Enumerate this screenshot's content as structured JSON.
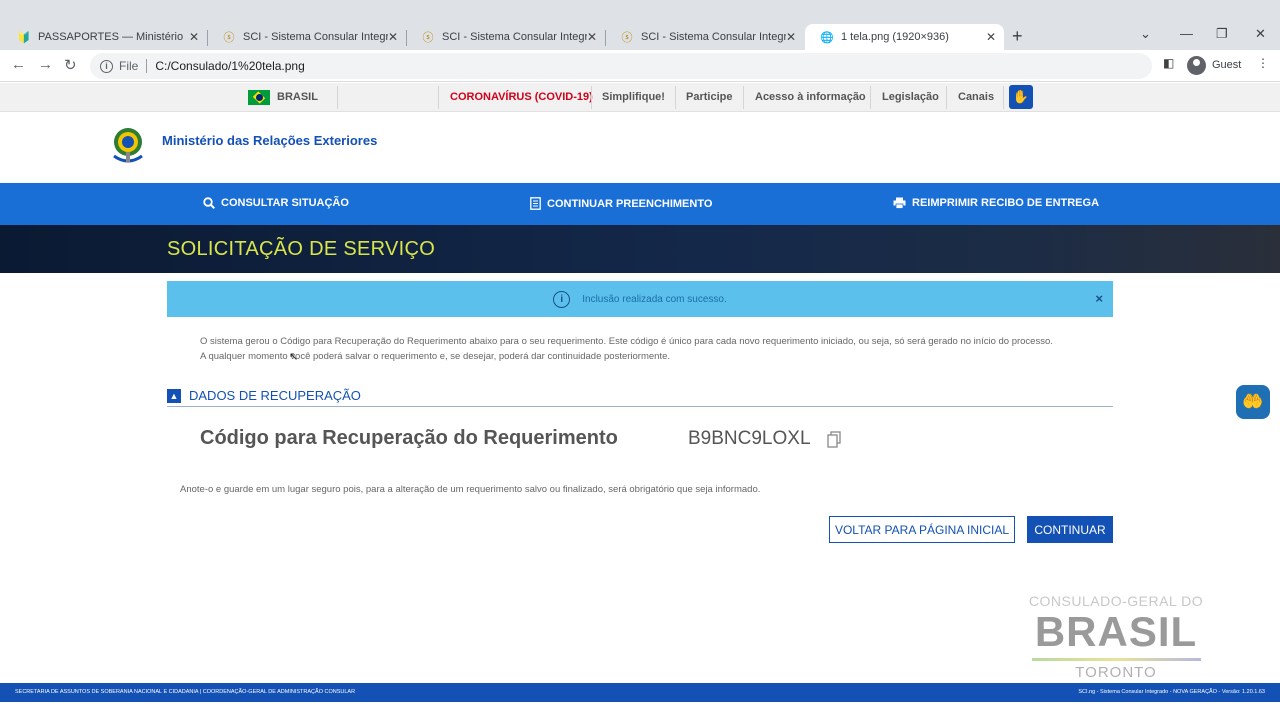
{
  "browser": {
    "tabs": [
      {
        "title": "PASSAPORTES — Ministério das",
        "icon": "gov-favicon"
      },
      {
        "title": "SCI - Sistema Consular Integrado",
        "icon": "sci-favicon"
      },
      {
        "title": "SCI - Sistema Consular Integrado",
        "icon": "sci-favicon"
      },
      {
        "title": "SCI - Sistema Consular Integrado",
        "icon": "sci-favicon"
      },
      {
        "title": "1 tela.png (1920×936)",
        "icon": "globe-icon"
      }
    ],
    "address": {
      "scheme_label": "File",
      "url": "C:/Consulado/1%20tela.png"
    },
    "profile_label": "Guest"
  },
  "govbar": {
    "country": "BRASIL",
    "links": [
      "CORONAVÍRUS (COVID-19)",
      "Simplifique!",
      "Participe",
      "Acesso à informação",
      "Legislação",
      "Canais"
    ]
  },
  "header": {
    "ministry": "Ministério das Relações Exteriores"
  },
  "nav": {
    "consultar": "CONSULTAR SITUAÇÃO",
    "continuar": "CONTINUAR PREENCHIMENTO",
    "reimprimir": "REIMPRIMIR RECIBO DE ENTREGA"
  },
  "banner": {
    "title": "SOLICITAÇÃO DE SERVIÇO"
  },
  "alert": {
    "message": "Inclusão realizada com sucesso.",
    "close": "×"
  },
  "intro": {
    "line1": "O sistema gerou o Código para Recuperação do Requerimento abaixo para o seu requerimento. Este código é único para cada novo requerimento iniciado, ou seja, só será gerado no início do processo.",
    "line2": "A qualquer momento você poderá salvar o requerimento e, se desejar, poderá dar continuidade posteriormente."
  },
  "section": {
    "title": "DADOS DE RECUPERAÇÃO"
  },
  "recovery": {
    "label": "Código para Recuperação do Requerimento",
    "code": "B9BNC9LOXL"
  },
  "note": "Anote-o e guarde em um lugar seguro pois, para a alteração de um requerimento salvo ou finalizado, será obrigatório que seja informado.",
  "buttons": {
    "back": "VOLTAR PARA PÁGINA INICIAL",
    "continue": "CONTINUAR"
  },
  "watermark": {
    "line1": "CONSULADO-GERAL DO",
    "line2": "BRASIL",
    "line3": "TORONTO"
  },
  "footer": {
    "left": "SECRETARIA DE ASSUNTOS DE SOBERANIA NACIONAL E CIDADANIA | COORDENAÇÃO-GERAL DE ADMINISTRAÇÃO CONSULAR",
    "right": "SCI.ng - Sistema Consular Integrado - NOVA GERAÇÃO - Versão: 1.20.1.63"
  },
  "colors": {
    "brand_blue": "#1351b4",
    "nav_blue": "#1a6fd6",
    "alert_bg": "#5bc0eb",
    "covid_red": "#d0021b",
    "banner_title": "#d9e64a"
  }
}
